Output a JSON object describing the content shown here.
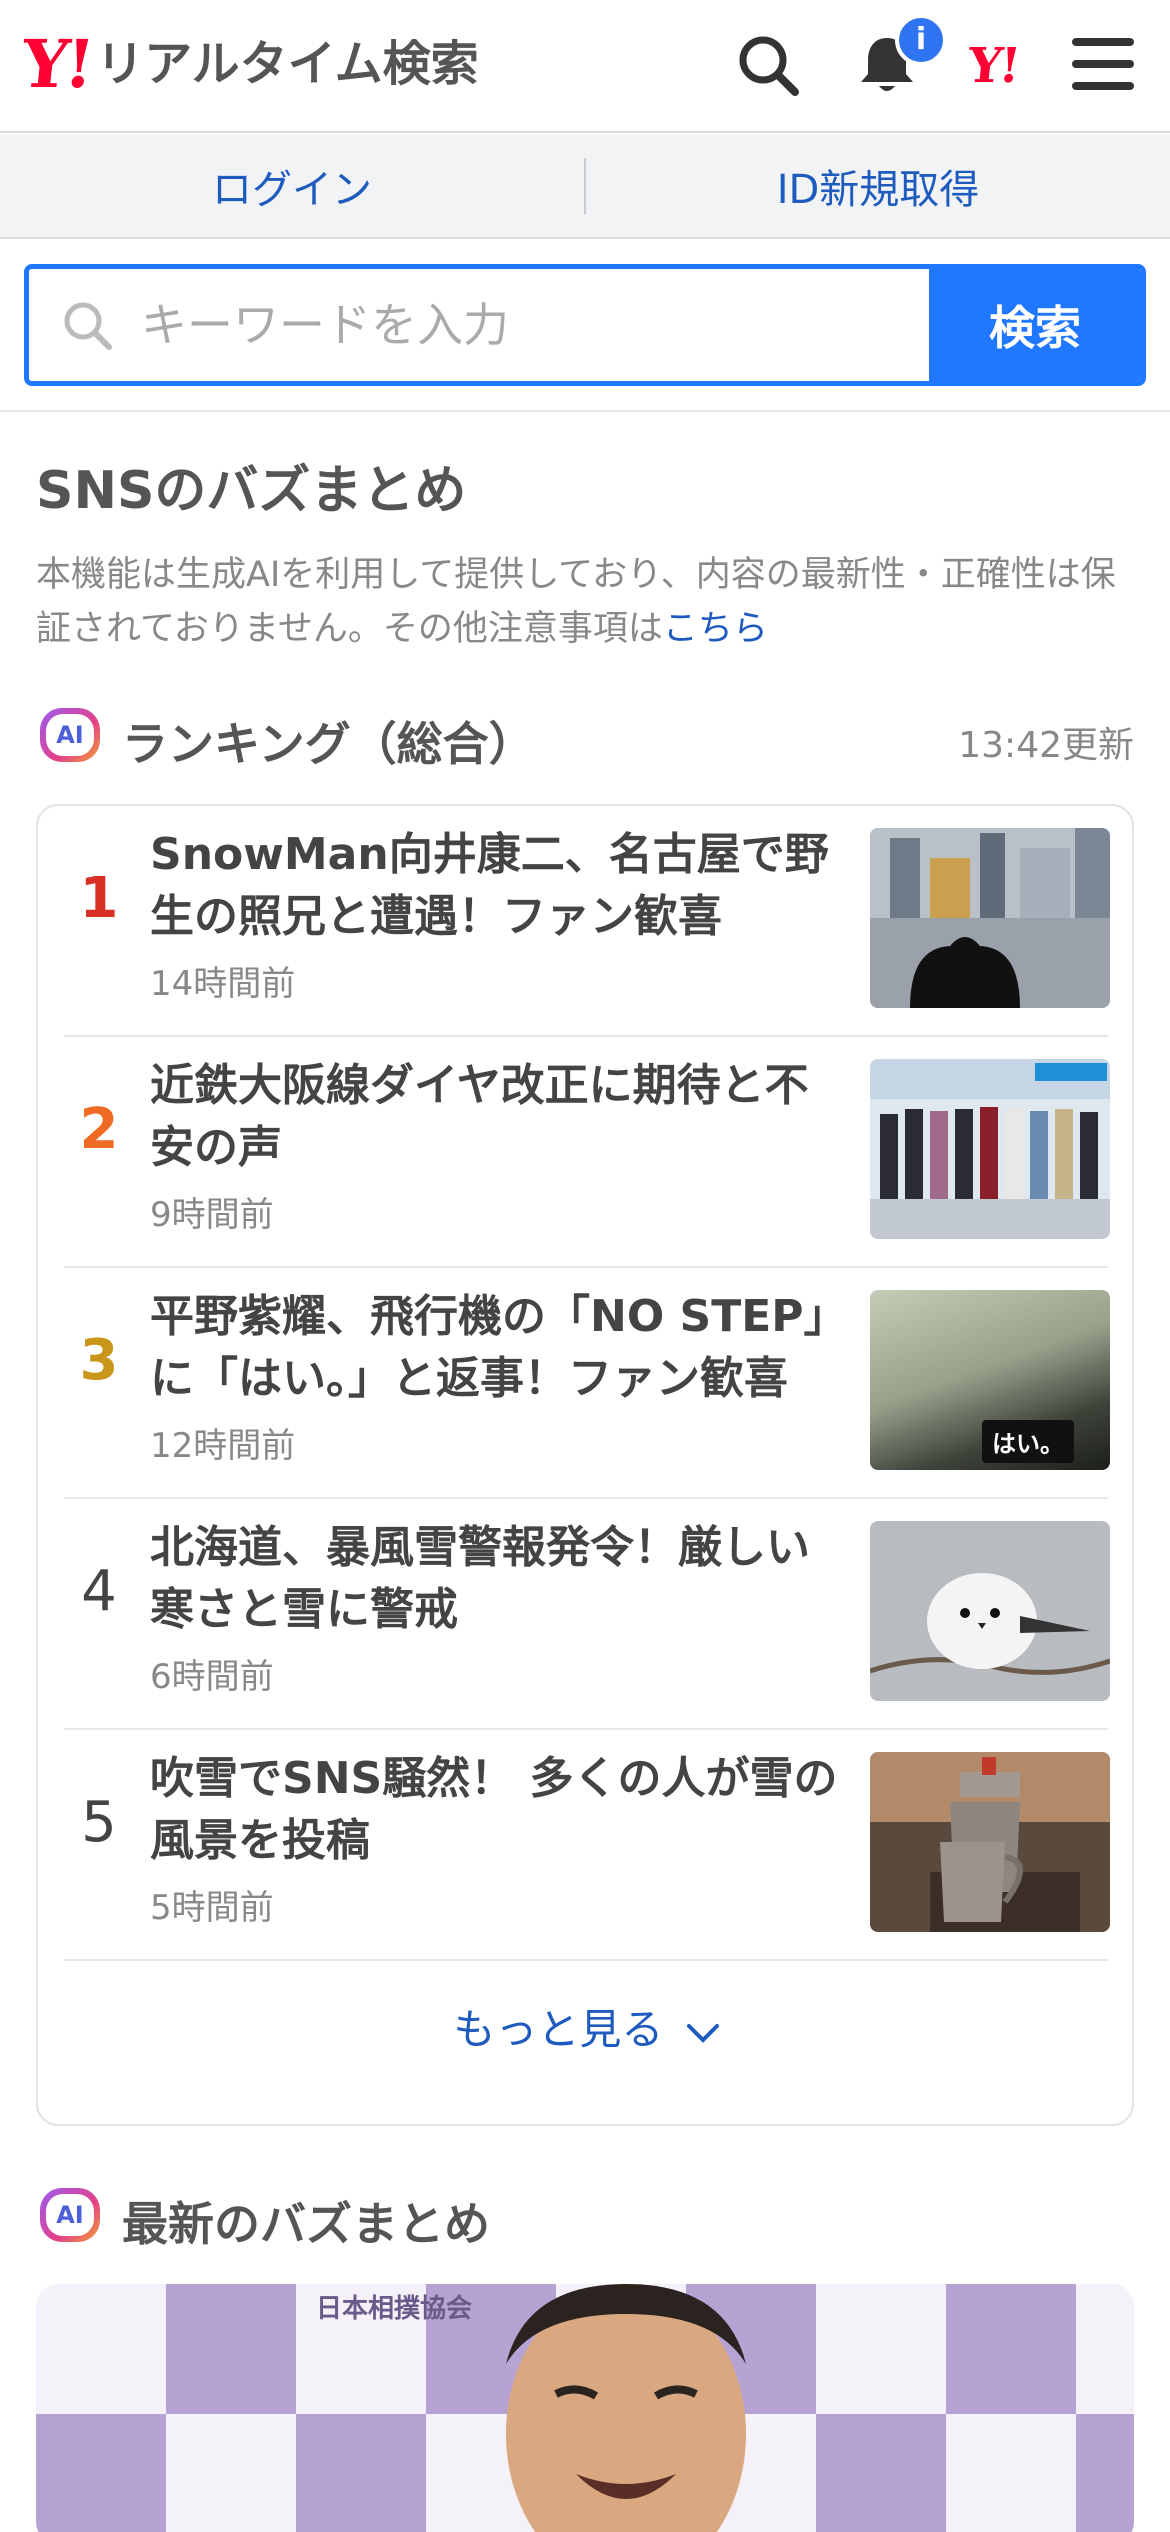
{
  "header": {
    "logo_mark": "Y!",
    "logo_text": "リアルタイム検索",
    "notification_badge": "i",
    "yahoo_mark": "Y!"
  },
  "auth": {
    "login": "ログイン",
    "register": "ID新規取得"
  },
  "search": {
    "placeholder": "キーワードを入力",
    "button": "検索"
  },
  "buzz": {
    "title": "SNSのバズまとめ",
    "notice": "本機能は生成AIを利用して提供しており、内容の最新性・正確性は保証されておりません。その他注意事項は",
    "notice_link": "こちら"
  },
  "ranking": {
    "ai_label": "AI",
    "title": "ランキング（総合）",
    "updated": "13:42更新",
    "items": [
      {
        "rank": "1",
        "title": "SnowMan向井康二、名古屋で野生の照兄と遭遇！ファン歓喜",
        "time": "14時間前",
        "color": "#d93025"
      },
      {
        "rank": "2",
        "title": "近鉄大阪線ダイヤ改正に期待と不安の声",
        "time": "9時間前",
        "color": "#ef6a22"
      },
      {
        "rank": "3",
        "title": "平野紫耀、飛行機の「NO STEP」に「はい。」と返事！ファン歓喜",
        "time": "12時間前",
        "color": "#c9961a"
      },
      {
        "rank": "4",
        "title": "北海道、暴風雪警報発令！厳しい寒さと雪に警戒",
        "time": "6時間前",
        "color": "#444444"
      },
      {
        "rank": "5",
        "title": "吹雪でSNS騒然！ 多くの人が雪の風景を投稿",
        "time": "5時間前",
        "color": "#444444"
      }
    ],
    "thumb3_caption": "はい。",
    "more": "もっと見る"
  },
  "latest": {
    "ai_label": "AI",
    "title": "最新のバズまとめ",
    "banner_text": "日本相撲協会"
  }
}
